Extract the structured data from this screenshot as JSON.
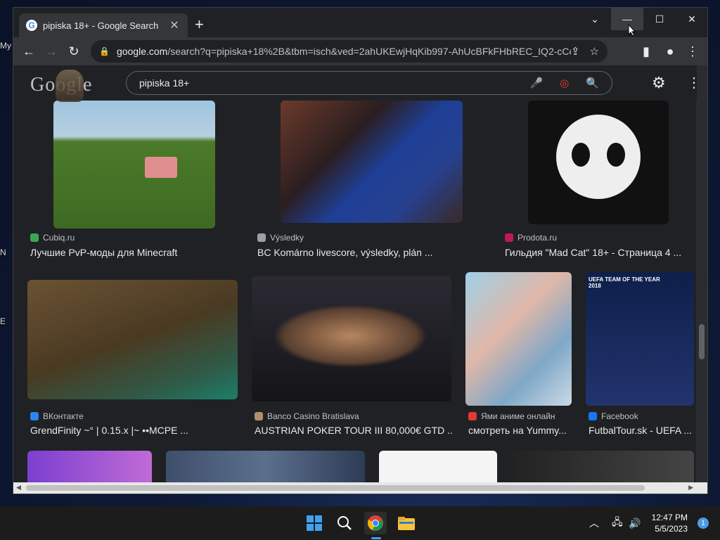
{
  "desktop": {
    "fragments": [
      "My",
      "N",
      "E"
    ]
  },
  "tab": {
    "title": "pipiska 18+ - Google Search",
    "close": "✕",
    "new": "+"
  },
  "window_controls": {
    "tab_search": "⌄",
    "minimize": "—",
    "maximize": "☐",
    "close": "✕"
  },
  "toolbar": {
    "back": "←",
    "forward": "→",
    "reload": "↻",
    "url_domain": "google.com",
    "url_rest": "/search?q=pipiska+18%2B&tbm=isch&ved=2ahUKEwjHqKib997-AhUcBFkFHbREC_IQ2-cCegQ...",
    "share": "⇪",
    "star": "☆",
    "sidepanel": "▮",
    "profile": "●",
    "menu": "⋮"
  },
  "google": {
    "logo": "Google",
    "query": "pipiska 18+",
    "mic": "🎤",
    "lens": "◎",
    "search": "🔍",
    "settings": "⚙",
    "apps": "⋮⋮"
  },
  "results": [
    {
      "source": "Cubiq.ru",
      "caption": "Лучшие PvP-моды для Minecraft",
      "fav_color": "#3aa655"
    },
    {
      "source": "Výsledky",
      "caption": "BC Komárno livescore, výsledky, plán ...",
      "fav_color": "#9aa0a6"
    },
    {
      "source": "Prodota.ru",
      "caption": "Гильдия \"Mad Cat\" 18+ - Страница 4 ...",
      "fav_color": "#c2185b"
    },
    {
      "source": "ВКонтакте",
      "caption": "GrendFinity ~° | 0.15.x |~ ••MCPE ...",
      "fav_color": "#2787f5"
    },
    {
      "source": "Banco Casino Bratislava",
      "caption": "AUSTRIAN POKER TOUR III 80,000€ GTD ...",
      "fav_color": "#b0906a"
    },
    {
      "source": "Ями аниме онлайн",
      "caption": "смотреть на Yummy...",
      "fav_color": "#e53935"
    },
    {
      "source": "Facebook",
      "caption": "FutbalTour.sk - UEFA ...",
      "fav_color": "#1877f2"
    }
  ],
  "thumb_text": {
    "ufa": "UEFA TEAM OF THE YEAR 2018"
  },
  "taskbar": {
    "time": "12:47 PM",
    "date": "5/5/2023",
    "notifications": "1"
  }
}
